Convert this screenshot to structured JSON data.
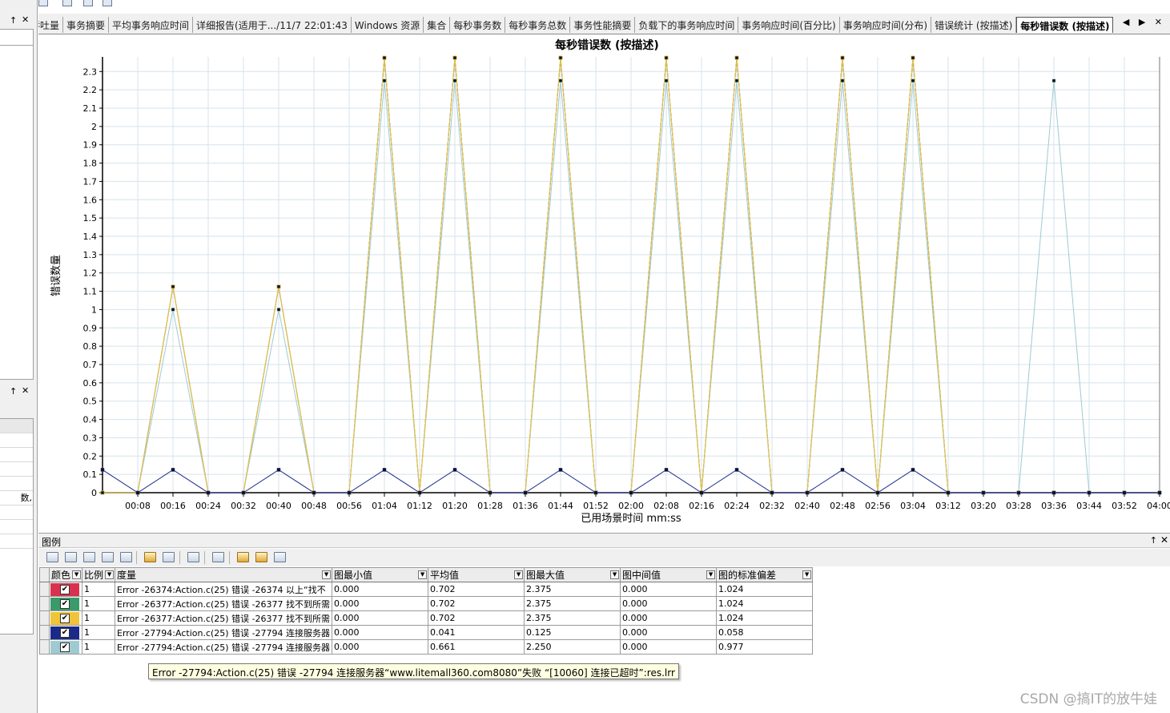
{
  "left_panel": {
    "top_pane": {
      "pin": "↑",
      "close": "✕"
    },
    "bottom_pane": {
      "pin": "↑",
      "close": "✕",
      "rows": [
        "",
        "",
        "",
        "",
        "",
        "数,",
        "",
        "",
        ""
      ]
    }
  },
  "tabs": [
    {
      "label": "吞吐量"
    },
    {
      "label": "事务摘要"
    },
    {
      "label": "平均事务响应时间"
    },
    {
      "label": "详细报告(适用于.../11/7 22:01:43"
    },
    {
      "label": "Windows 资源"
    },
    {
      "label": "集合"
    },
    {
      "label": "每秒事务数"
    },
    {
      "label": "每秒事务总数"
    },
    {
      "label": "事务性能摘要"
    },
    {
      "label": "负载下的事务响应时间"
    },
    {
      "label": "事务响应时间(百分比)"
    },
    {
      "label": "事务响应时间(分布)"
    },
    {
      "label": "错误统计 (按描述)"
    },
    {
      "label": "每秒错误数 (按描述)",
      "active": true
    }
  ],
  "tab_arrows": "◀ ▶ ✕",
  "chart_data": {
    "type": "line",
    "title": "每秒错误数 (按描述)",
    "xlabel": "已用场景时间 mm:ss",
    "ylabel": "错误数量",
    "xlim": [
      0,
      240
    ],
    "ylim": [
      0,
      2.38
    ],
    "x_ticks": [
      8,
      16,
      24,
      32,
      40,
      48,
      56,
      64,
      72,
      80,
      88,
      96,
      104,
      112,
      120,
      128,
      136,
      144,
      152,
      160,
      168,
      176,
      184,
      192,
      200,
      208,
      216,
      224,
      232,
      240
    ],
    "x_tick_labels": [
      "00:08",
      "00:16",
      "00:24",
      "00:32",
      "00:40",
      "00:48",
      "00:56",
      "01:04",
      "01:12",
      "01:20",
      "01:28",
      "01:36",
      "01:44",
      "01:52",
      "02:00",
      "02:08",
      "02:16",
      "02:24",
      "02:32",
      "02:40",
      "02:48",
      "02:56",
      "03:04",
      "03:12",
      "03:20",
      "03:28",
      "03:36",
      "03:44",
      "03:52",
      "04:00"
    ],
    "y_ticks": [
      0,
      0.1,
      0.2,
      0.3,
      0.4,
      0.5,
      0.6,
      0.7,
      0.8,
      0.9,
      1,
      1.1,
      1.2,
      1.3,
      1.4,
      1.5,
      1.6,
      1.7,
      1.8,
      1.9,
      2,
      2.1,
      2.2,
      2.3
    ],
    "y_tick_labels": [
      "0",
      "0.1",
      "0.2",
      "0.3",
      "0.4",
      "0.5",
      "0.6",
      "0.7",
      "0.8",
      "0.9",
      "1",
      "1.1",
      "1.2",
      "1.3",
      "1.4",
      "1.5",
      "1.6",
      "1.7",
      "1.8",
      "1.9",
      "2",
      "2.1",
      "2.2",
      "2.3"
    ],
    "grid": true,
    "x": [
      0,
      8,
      16,
      24,
      32,
      40,
      48,
      56,
      64,
      72,
      80,
      88,
      96,
      104,
      112,
      120,
      128,
      136,
      144,
      152,
      160,
      168,
      176,
      184,
      192,
      200,
      208,
      216,
      224,
      232,
      240
    ],
    "series": [
      {
        "name": "Error -26374:Action.c(25) 错误 -26374 以上“找不",
        "color": "#d8324f",
        "marker": "square",
        "values": [
          0,
          0,
          1.125,
          0,
          0,
          1.125,
          0,
          0,
          2.375,
          0,
          2.375,
          0,
          0,
          2.375,
          0,
          0,
          2.375,
          0,
          2.375,
          0,
          0,
          2.375,
          0,
          2.375,
          0,
          0,
          0,
          0,
          0,
          0,
          0
        ]
      },
      {
        "name": "Error -26377:Action.c(25) 错误 -26377 找不到所需",
        "color": "#3a9a6a",
        "marker": "square",
        "values": [
          0,
          0,
          1.125,
          0,
          0,
          1.125,
          0,
          0,
          2.375,
          0,
          2.375,
          0,
          0,
          2.375,
          0,
          0,
          2.375,
          0,
          2.375,
          0,
          0,
          2.375,
          0,
          2.375,
          0,
          0,
          0,
          0,
          0,
          0,
          0
        ]
      },
      {
        "name": "Error -26377:Action.c(25) 错误 -26377 找不到所需",
        "color": "#f0c43a",
        "marker": "square",
        "values": [
          0,
          0,
          1.125,
          0,
          0,
          1.125,
          0,
          0,
          2.375,
          0,
          2.375,
          0,
          0,
          2.375,
          0,
          0,
          2.375,
          0,
          2.375,
          0,
          0,
          2.375,
          0,
          2.375,
          0,
          0,
          0,
          0,
          0,
          0,
          0
        ]
      },
      {
        "name": "Error -27794:Action.c(25) 错误 -27794 连接服务器",
        "color": "#1a2a8a",
        "marker": "square",
        "values": [
          0.125,
          0,
          0.125,
          0,
          0,
          0.125,
          0,
          0,
          0.125,
          0,
          0.125,
          0,
          0,
          0.125,
          0,
          0,
          0.125,
          0,
          0.125,
          0,
          0,
          0.125,
          0,
          0.125,
          0,
          0,
          0,
          0,
          0,
          0,
          0
        ]
      },
      {
        "name": "Error -27794:Action.c(25) 错误 -27794 连接服务器",
        "color": "#9fcad2",
        "marker": "square",
        "values": [
          0,
          0,
          1,
          0,
          0,
          1,
          0,
          0,
          2.25,
          0,
          2.25,
          0,
          0,
          2.25,
          0,
          0,
          2.25,
          0,
          2.25,
          0,
          0,
          2.25,
          0,
          2.25,
          0,
          0,
          0,
          2.25,
          0,
          0,
          0
        ]
      }
    ]
  },
  "legend": {
    "title": "图例",
    "pin": "↑",
    "close": "✕",
    "columns": [
      "颜色",
      "比例",
      "度量",
      "图最小值",
      "平均值",
      "图最大值",
      "图中间值",
      "图的标准偏差"
    ],
    "rows": [
      {
        "color": "#d8324f",
        "checked": "✔",
        "scale": "1",
        "measure": "Error -26374:Action.c(25) 错误 -26374 以上“找不",
        "min": "0.000",
        "avg": "0.702",
        "max": "2.375",
        "median": "0.000",
        "std": "1.024"
      },
      {
        "color": "#3a9a6a",
        "checked": "✔",
        "scale": "1",
        "measure": "Error -26377:Action.c(25) 错误 -26377 找不到所需",
        "min": "0.000",
        "avg": "0.702",
        "max": "2.375",
        "median": "0.000",
        "std": "1.024"
      },
      {
        "color": "#f0c43a",
        "checked": "✔",
        "scale": "1",
        "measure": "Error -26377:Action.c(25) 错误 -26377 找不到所需",
        "min": "0.000",
        "avg": "0.702",
        "max": "2.375",
        "median": "0.000",
        "std": "1.024"
      },
      {
        "color": "#1a2a8a",
        "checked": "✔",
        "scale": "1",
        "measure": "Error -27794:Action.c(25) 错误 -27794 连接服务器",
        "min": "0.000",
        "avg": "0.041",
        "max": "0.125",
        "median": "0.000",
        "std": "0.058"
      },
      {
        "color": "#9fcad2",
        "checked": "✔",
        "scale": "1",
        "measure": "Error -27794:Action.c(25) 错误 -27794 连接服务器",
        "min": "0.000",
        "avg": "0.661",
        "max": "2.250",
        "median": "0.000",
        "std": "0.977"
      }
    ]
  },
  "tooltip": "Error -27794:Action.c(25) 错误 -27794 连接服务器“www.litemall360.com8080”失败 “[10060] 连接已超时”:res.lrr",
  "watermark": "CSDN @搞IT的放牛娃"
}
